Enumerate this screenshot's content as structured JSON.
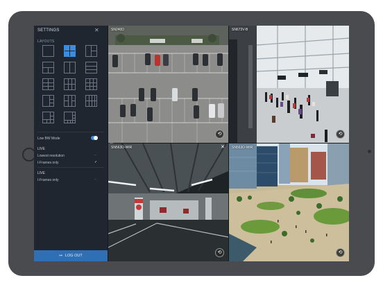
{
  "settings": {
    "title": "SETTINGS",
    "close_icon": "close-icon",
    "layouts_label": "LAYOUTS",
    "low_bw_label": "Low BW Mode",
    "live_section_1": "LIVE",
    "lowest_resolution": "Lowest resolution",
    "iframes_only_1": "I-Frames only",
    "live_section_2": "LIVE",
    "iframes_only_2": "I-Frames only",
    "logout_label": "LOG OUT",
    "accent_color": "#3a8de0"
  },
  "cameras": [
    {
      "title": "SN240D",
      "scene": "parking-lot-aerial"
    },
    {
      "title": "SN673V-B",
      "scene": "station-concourse"
    },
    {
      "title": "SN563D-WIR",
      "scene": "underground-garage"
    },
    {
      "title": "SN563D-WIR",
      "scene": "city-plaza"
    }
  ]
}
